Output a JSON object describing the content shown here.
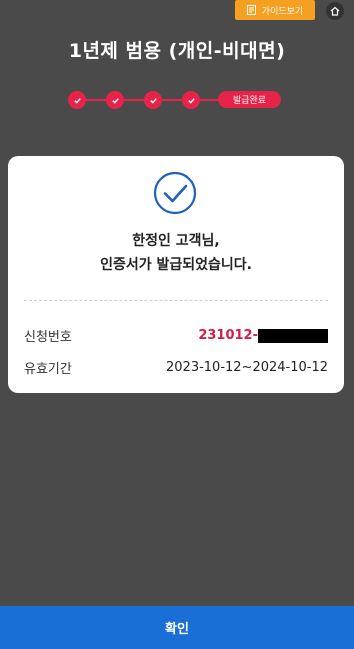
{
  "header": {
    "guide_label": "가이드보기",
    "title": "1년제 범용 (개인-비대면)"
  },
  "progress": {
    "completed_steps": 4,
    "current_step_label": "발급완료"
  },
  "card": {
    "message_line1": "한정인 고객님,",
    "message_line2": "인증서가 발급되었습니다.",
    "application_number_label": "신청번호",
    "application_number_prefix": "231012-",
    "validity_label": "유효기간",
    "validity_value": "2023-10-12~2024-10-12"
  },
  "footer": {
    "confirm_label": "확인"
  },
  "colors": {
    "accent_red": "#e8234a",
    "guide_orange": "#f5a020",
    "confirm_blue": "#1a6fd6",
    "check_blue": "#1f5fbf"
  },
  "icons": {
    "guide": "document-icon",
    "home": "home-icon",
    "step": "check-icon",
    "success": "check-circle-icon"
  }
}
